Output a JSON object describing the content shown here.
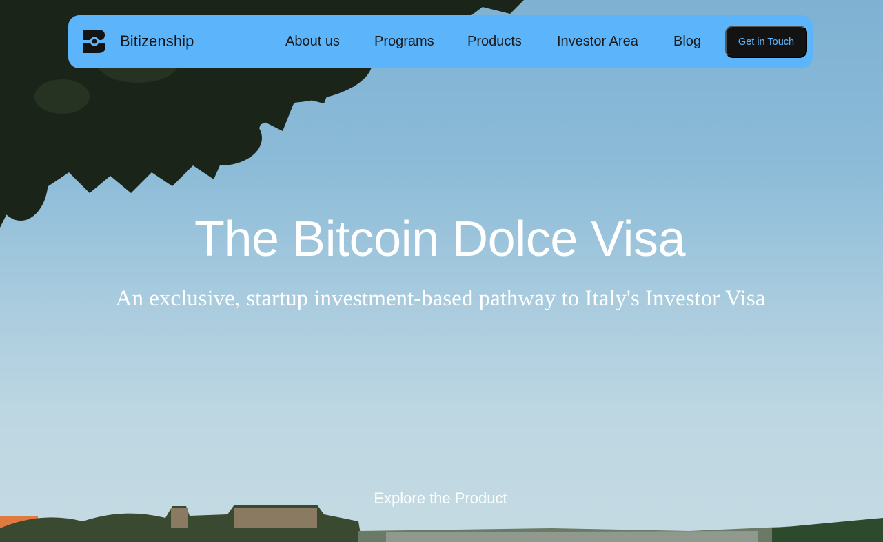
{
  "brand": {
    "name": "Bitizenship",
    "logo_icon": "bitizenship-logo-icon"
  },
  "nav": {
    "items": [
      {
        "label": "About us"
      },
      {
        "label": "Programs"
      },
      {
        "label": "Products"
      },
      {
        "label": "Investor Area"
      },
      {
        "label": "Blog"
      }
    ],
    "cta_label": "Get in Touch"
  },
  "hero": {
    "title": "The Bitcoin Dolce Visa",
    "subtitle": "An exclusive, startup investment-based pathway to Italy's Investor Visa",
    "explore_label": "Explore the Product"
  },
  "colors": {
    "navbar": "#5cb5fb",
    "cta_background": "#131313",
    "cta_text": "#5cb5fb",
    "sky": "#8bbbd8",
    "text_on_image": "#ffffff"
  }
}
